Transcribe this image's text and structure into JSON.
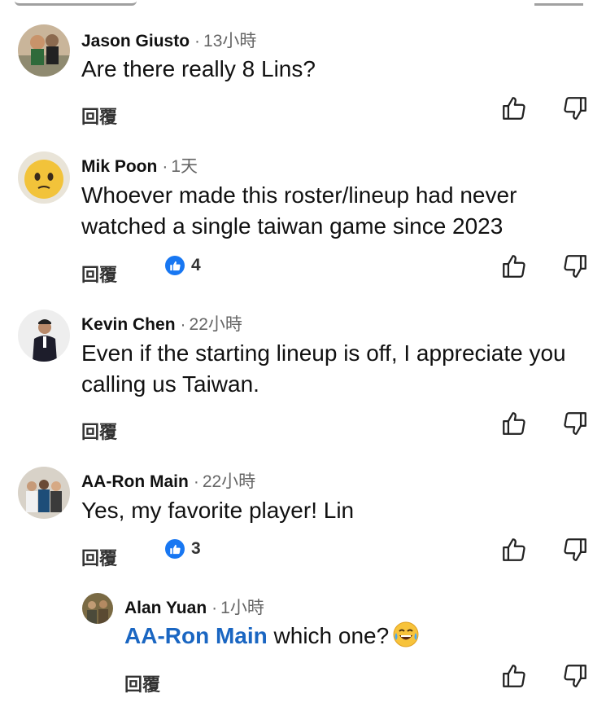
{
  "labels": {
    "reply": "回覆",
    "dot": "·"
  },
  "accent": {
    "mention": "#1a66c2",
    "like_badge": "#1877f2"
  },
  "comments": [
    {
      "author": "Jason Giusto",
      "time": "13小時",
      "text": "Are there really 8 Lins?",
      "likes": null
    },
    {
      "author": "Mik Poon",
      "time": "1天",
      "text": "Whoever made this roster/lineup had never watched a single taiwan game since 2023",
      "likes": "4"
    },
    {
      "author": "Kevin Chen",
      "time": "22小時",
      "text": "Even if the starting lineup is off, I appreciate you calling us Taiwan.",
      "likes": null
    },
    {
      "author": "AA-Ron Main",
      "time": "22小時",
      "text": "Yes, my favorite player! Lin",
      "likes": "3"
    }
  ],
  "reply_thread": {
    "author": "Alan Yuan",
    "time": "1小時",
    "mention": "AA-Ron Main",
    "text": " which one?",
    "emoji": "laughing-crying-emoji"
  }
}
